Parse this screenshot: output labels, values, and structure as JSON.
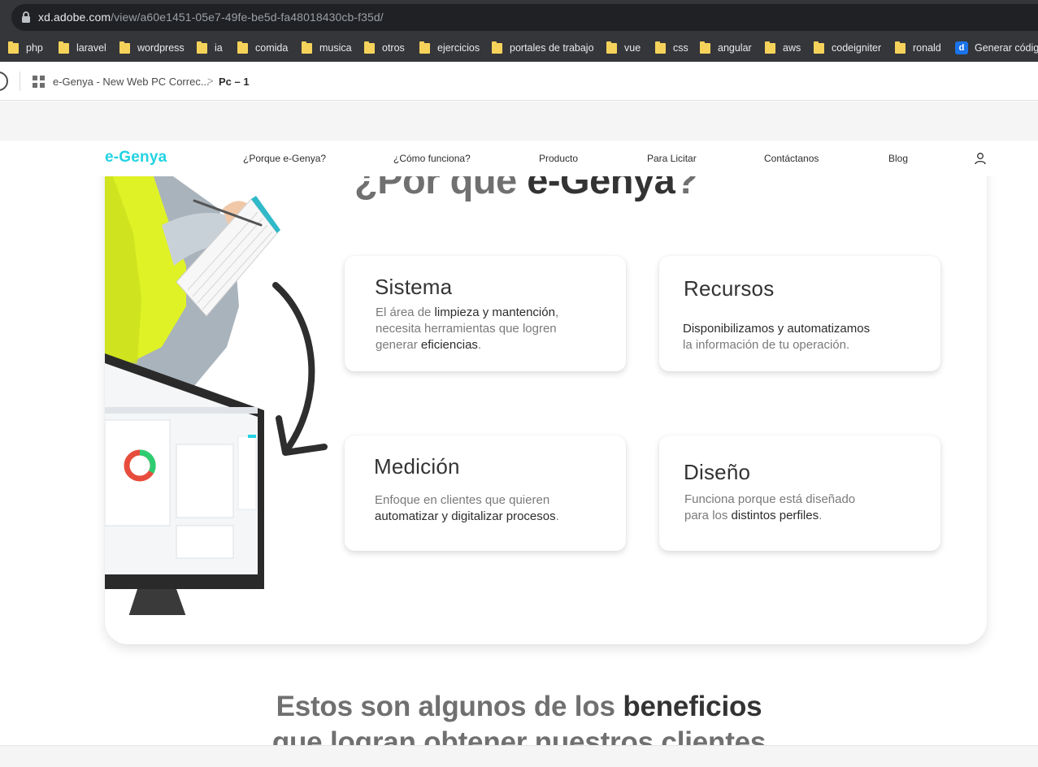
{
  "browser": {
    "url_host": "xd.adobe.com",
    "url_path": "/view/a60e1451-05e7-49fe-be5d-fa48018430cb-f35d/",
    "bookmarks": [
      {
        "label": "php",
        "icon": "folder-icon"
      },
      {
        "label": "laravel",
        "icon": "folder-icon"
      },
      {
        "label": "wordpress",
        "icon": "folder-icon"
      },
      {
        "label": "ia",
        "icon": "folder-icon"
      },
      {
        "label": "comida",
        "icon": "folder-icon"
      },
      {
        "label": "musica",
        "icon": "folder-icon"
      },
      {
        "label": "otros",
        "icon": "folder-icon"
      },
      {
        "label": "ejercicios",
        "icon": "folder-icon"
      },
      {
        "label": "portales de trabajo",
        "icon": "folder-icon"
      },
      {
        "label": "vue",
        "icon": "folder-icon"
      },
      {
        "label": "css",
        "icon": "folder-icon"
      },
      {
        "label": "angular",
        "icon": "folder-icon"
      },
      {
        "label": "aws",
        "icon": "folder-icon"
      },
      {
        "label": "codeigniter",
        "icon": "folder-icon"
      },
      {
        "label": "ronald",
        "icon": "folder-icon"
      },
      {
        "label": "Generar código",
        "icon": "app-icon"
      }
    ]
  },
  "xd_viewer": {
    "document_name": "e-Genya - New Web PC Correc...",
    "breadcrumb_separator": ">",
    "page_name": "Pc – 1"
  },
  "site": {
    "logo": "e-Genya",
    "nav": [
      {
        "label": "¿Porque e-Genya?"
      },
      {
        "label": "¿Cómo funciona?"
      },
      {
        "label": "Producto"
      },
      {
        "label": "Para Licitar"
      },
      {
        "label": "Contáctanos"
      },
      {
        "label": "Blog"
      }
    ],
    "section_title_light": "¿Por qué ",
    "section_title_strong": "e-Genya",
    "section_title_end": "?",
    "features": [
      {
        "title": "Sistema",
        "lines": [
          [
            {
              "t": "El área de ",
              "b": false
            },
            {
              "t": "limpieza y mantención",
              "b": true
            },
            {
              "t": ",",
              "b": false
            }
          ],
          [
            {
              "t": "necesita herramientas que logren",
              "b": false
            }
          ],
          [
            {
              "t": "generar ",
              "b": false
            },
            {
              "t": "eficiencias",
              "b": true
            },
            {
              "t": ".",
              "b": false
            }
          ]
        ]
      },
      {
        "title": "Recursos",
        "lines": [
          [
            {
              "t": "Disponibilizamos y automatizamos",
              "b": true
            }
          ],
          [
            {
              "t": "la información de tu operación.",
              "b": false
            }
          ]
        ]
      },
      {
        "title": "Medición",
        "lines": [
          [
            {
              "t": "Enfoque en clientes que quieren",
              "b": false
            }
          ],
          [
            {
              "t": "automatizar y digitalizar procesos",
              "b": true
            },
            {
              "t": ".",
              "b": false
            }
          ]
        ]
      },
      {
        "title": "Diseño",
        "lines": [
          [
            {
              "t": "Funciona porque está diseñado",
              "b": false
            }
          ],
          [
            {
              "t": "para los ",
              "b": false
            },
            {
              "t": "distintos perfiles",
              "b": true
            },
            {
              "t": ".",
              "b": false
            }
          ]
        ]
      }
    ],
    "benefits_line1_light": "Estos son algunos de los ",
    "benefits_line1_strong": "beneficios",
    "benefits_line2": "que logran obtener nuestros clientes"
  },
  "colors": {
    "brand_cyan": "#23d3e3",
    "safety_vest": "#dff226",
    "chart_green": "#2ecc71",
    "chart_red": "#e74c3c"
  },
  "icons": [
    "lock-icon",
    "folder-icon",
    "app-icon",
    "grid-icon",
    "user-icon",
    "curved-arrow-icon"
  ]
}
